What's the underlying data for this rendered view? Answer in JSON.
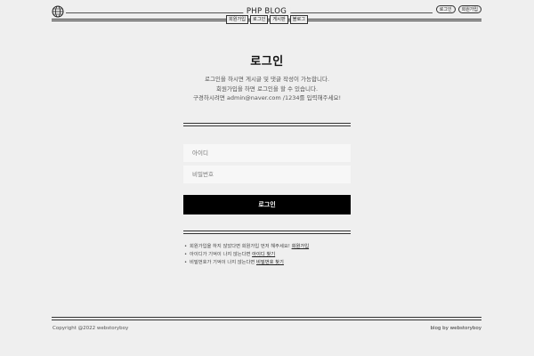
{
  "header": {
    "site_title": "PHP BLOG",
    "logo_icon": "globe-icon",
    "top_links": [
      "로그인",
      "회원가입"
    ],
    "nav": [
      "회원가입",
      "로그인",
      "게시판",
      "블로그"
    ]
  },
  "login": {
    "title": "로그인",
    "desc_lines": [
      "로그인을 하시면 게시글 및 댓글 작성이 가능합니다.",
      "회원가입을 하면 로그인을 할 수 있습니다.",
      "구경하시려면 admin@naver.com /1234를 입력해주세요!"
    ],
    "id_placeholder": "아이디",
    "pw_placeholder": "비밀번호",
    "button": "로그인"
  },
  "help": [
    {
      "text": "회원가입을 하지 않았다면 회원가입 먼저 해주세요! ",
      "link": "회원가입"
    },
    {
      "text": "아이디가 기억이 나지 않는다면 ",
      "link": "아이디 찾기"
    },
    {
      "text": "비밀번호가 기억이 나지 않는다면 ",
      "link": "비밀번호 찾기"
    }
  ],
  "footer": {
    "copyright": "Copyright @2022 webstoryboy",
    "credit": "blog by webstoryboy"
  }
}
